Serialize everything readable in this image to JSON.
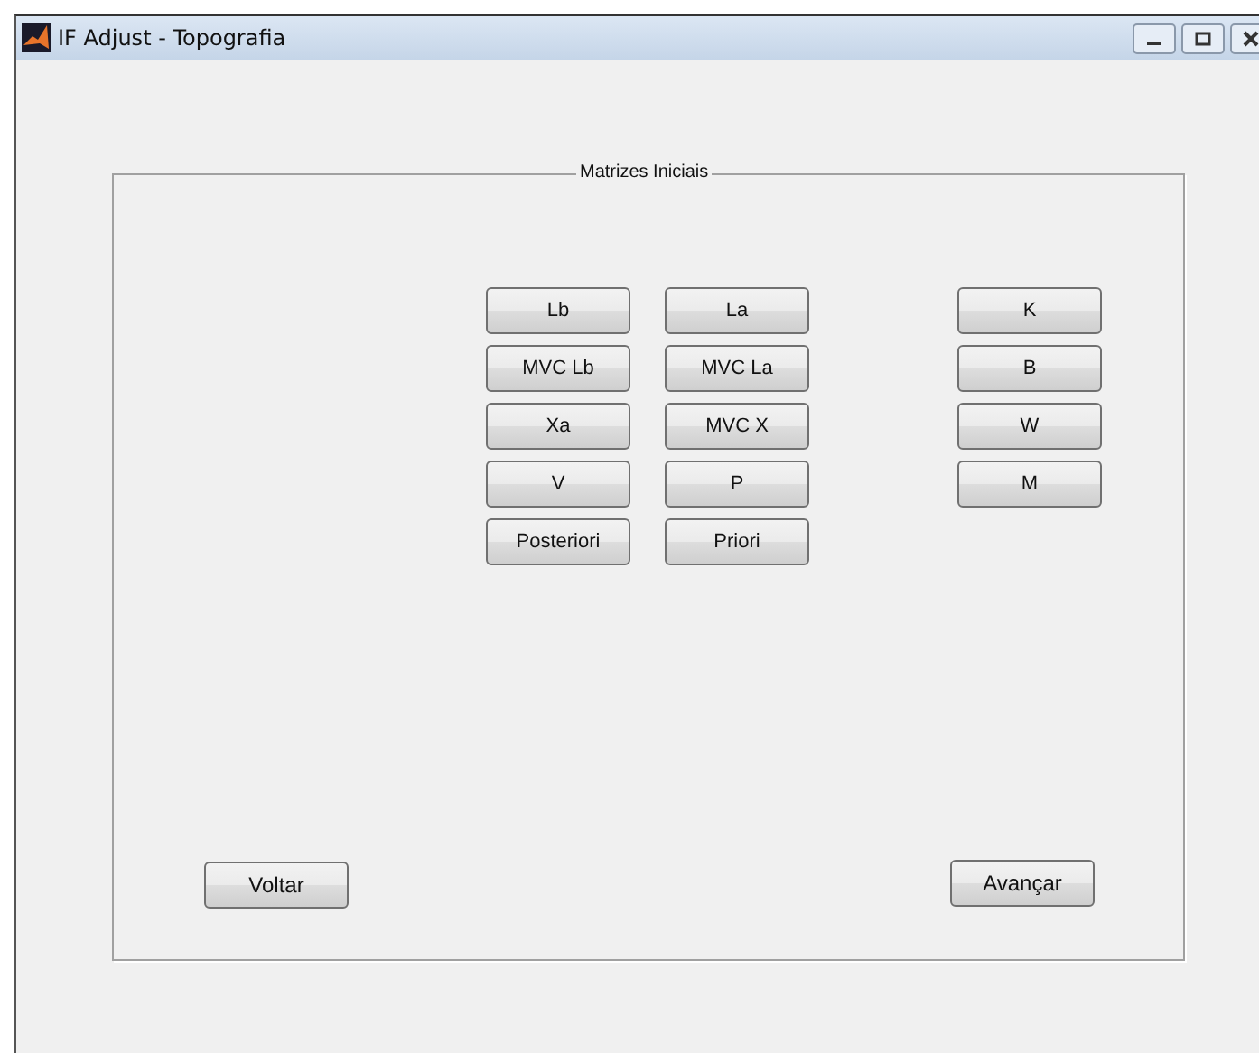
{
  "window": {
    "title": "IF Adjust - Topografia"
  },
  "panel": {
    "title": "Matrizes Iniciais",
    "columns": [
      [
        "Lb",
        "MVC Lb",
        "Xa",
        "V",
        "Posteriori"
      ],
      [
        "La",
        "MVC La",
        "MVC X",
        "P",
        "Priori"
      ],
      [
        "K",
        "B",
        "W",
        "M"
      ]
    ]
  },
  "nav_buttons": [
    {
      "label": "Voltar",
      "kind": "back"
    },
    {
      "label": "Avançar",
      "kind": "next"
    }
  ]
}
